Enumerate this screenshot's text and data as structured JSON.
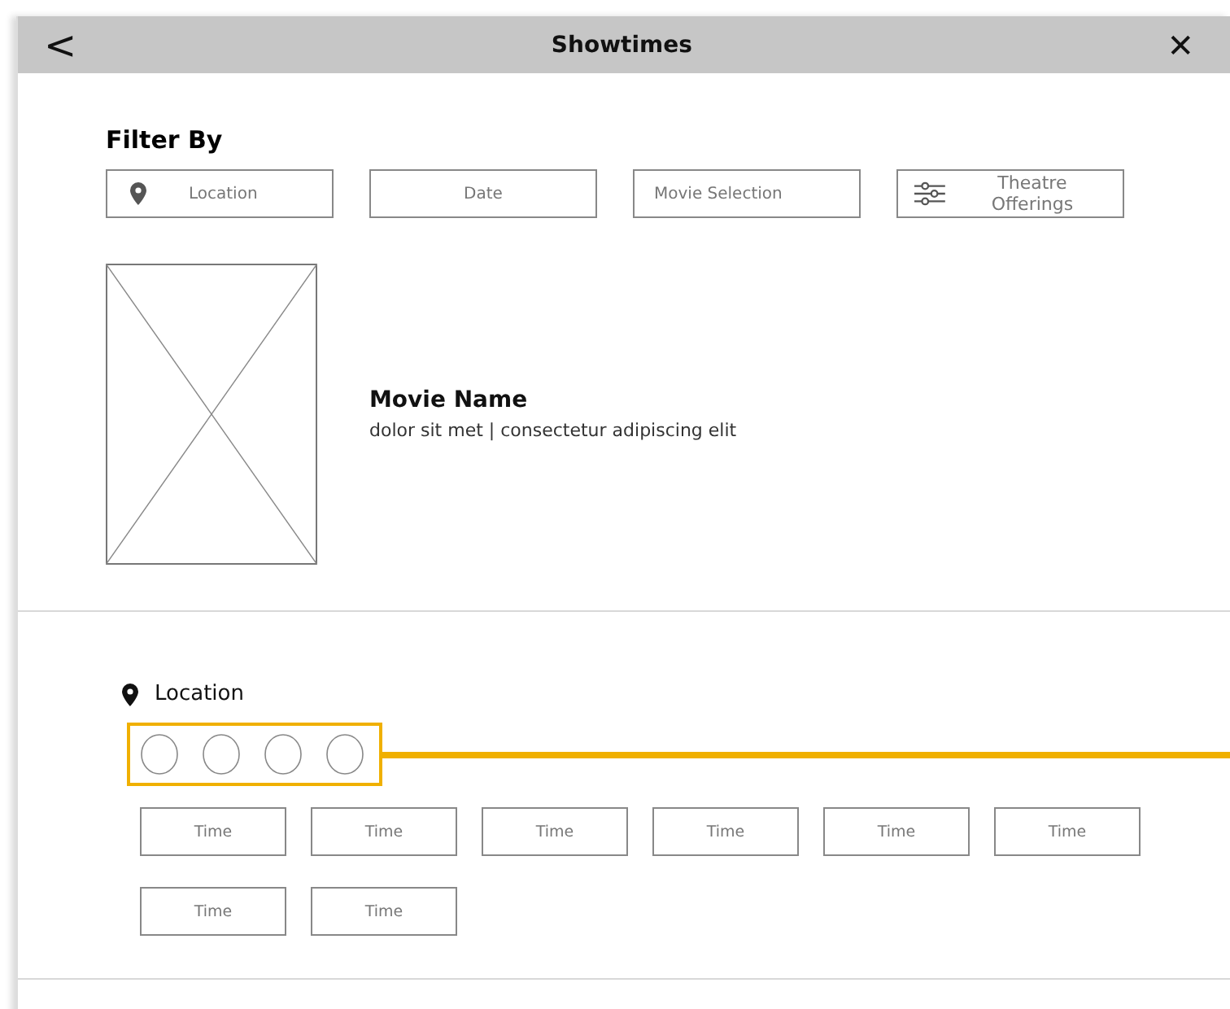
{
  "header": {
    "back": "<",
    "title": "Showtimes",
    "close": "✕"
  },
  "filter": {
    "heading": "Filter By",
    "fields": [
      {
        "kind": "pin",
        "label": "Location"
      },
      {
        "kind": "center",
        "label": "Date"
      },
      {
        "kind": "left",
        "label": "Movie Selection"
      },
      {
        "kind": "sliders",
        "label": "Theatre Offerings"
      }
    ]
  },
  "movie": {
    "name": "Movie Name",
    "details": "dolor sit met |  consectetur adipiscing elit"
  },
  "location": {
    "label": "Location",
    "times": [
      {
        "label": "Time"
      },
      {
        "label": "Time"
      },
      {
        "label": "Time"
      },
      {
        "label": "Time"
      },
      {
        "label": "Time"
      },
      {
        "label": "Time"
      },
      {
        "label": "Time"
      },
      {
        "label": "Time"
      }
    ]
  }
}
